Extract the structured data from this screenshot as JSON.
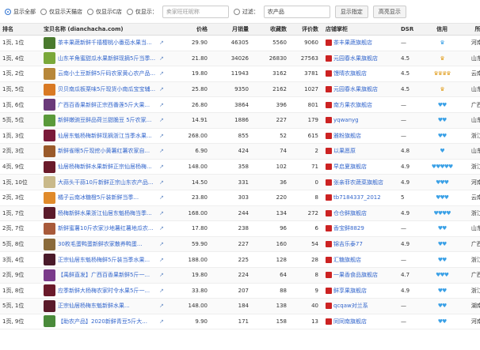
{
  "toolbar": {
    "radio_all": "显示全部",
    "radio_tmall": "仅显示天猫店",
    "radio_c": "仅显示C店",
    "radio_show": "仅显示：",
    "keyword_placeholder": "卖家旺旺昵称",
    "filter_label": "过滤：",
    "filter_value": "农产品",
    "btn_show_assign": "显示指定",
    "btn_highlight": "高亮显示"
  },
  "headers": [
    "排名",
    "宝贝名称 (dianchacha.com)",
    "价格",
    "月销量",
    "收藏数",
    "评价数",
    "店铺掌柜",
    "DSR",
    "信用",
    "所在地"
  ],
  "rows": [
    {
      "rank": "1页, 1位",
      "title": "茶丰果蔬新鲜千禧樱桃小番茄水果当...",
      "thumb": "#4a7a2e",
      "price": "29.90",
      "sales": "46305",
      "fav": "5560",
      "reviews": "9060",
      "shop_color": "#cc2222",
      "shop": "茶丰果蔬旗舰店",
      "dsr": "—",
      "credit": "♛",
      "credit_type": "blue",
      "loc": "河南 安阳"
    },
    {
      "rank": "1页, 4位",
      "title": "山东羊角蜜甜瓜水果新鲜现摘5斤当季...",
      "thumb": "#7aa83a",
      "price": "21.80",
      "sales": "34026",
      "fav": "26830",
      "reviews": "27563",
      "shop_color": "#cc2222",
      "shop": "元园春水果旗舰店",
      "dsr": "4.5",
      "credit": "♛",
      "credit_type": "gold",
      "loc": "山东 潍坊"
    },
    {
      "rank": "1页, 2位",
      "title": "云南小土豆新鲜5斤码农家黄心农产品...",
      "thumb": "#b7873a",
      "price": "19.80",
      "sales": "11943",
      "fav": "3162",
      "reviews": "3781",
      "shop_color": "#cc2222",
      "shop": "馒晴农旗舰店",
      "dsr": "4.5",
      "credit": "♛♛♛♛",
      "credit_type": "gold",
      "loc": "云南 昆明"
    },
    {
      "rank": "1页, 5位",
      "title": "贝贝南瓜板栗味5斤现货小南瓜宝宝辅...",
      "thumb": "#d97a24",
      "price": "25.80",
      "sales": "9350",
      "fav": "2162",
      "reviews": "1027",
      "shop_color": "#cc2222",
      "shop": "元园春水果旗舰店",
      "dsr": "4.5",
      "credit": "♛",
      "credit_type": "gold",
      "loc": "山东 潍坊"
    },
    {
      "rank": "1页, 6位",
      "title": "广西百香果新鲜正宗西番莲5斤大果...",
      "thumb": "#6a3a7a",
      "price": "26.80",
      "sales": "3864",
      "fav": "396",
      "reviews": "801",
      "shop_color": "#cc2222",
      "shop": "南方果农旗舰店",
      "dsr": "—",
      "credit": "♥♥",
      "credit_type": "blue",
      "loc": "广西 桂林"
    },
    {
      "rank": "5页, 5位",
      "title": "新鲜嫩豌豆鲜品荷兰甜脆豆 5斤农家...",
      "thumb": "#5a9a3a",
      "price": "14.91",
      "sales": "1886",
      "fav": "227",
      "reviews": "179",
      "shop_color": "#cc2222",
      "shop": "yqwanyg",
      "dsr": "—",
      "credit": "♥♥",
      "credit_type": "blue",
      "loc": "山东 烟台"
    },
    {
      "rank": "1页, 3位",
      "title": "仙居东魁杨梅新鲜现摘浙江当季水果...",
      "thumb": "#7a1a3a",
      "price": "268.00",
      "sales": "855",
      "fav": "52",
      "reviews": "615",
      "shop_color": "#cc2222",
      "shop": "雅粉旗舰店",
      "dsr": "—",
      "credit": "♥♥",
      "credit_type": "blue",
      "loc": "浙江 台州"
    },
    {
      "rank": "2页, 3位",
      "title": "新鲜雀眼5斤现挖小黄薯红薯农家自...",
      "thumb": "#9a5a2a",
      "price": "6.90",
      "sales": "424",
      "fav": "74",
      "reviews": "2",
      "shop_color": "#cc2222",
      "shop": "以果愿原",
      "dsr": "4.8",
      "credit": "♥",
      "credit_type": "blue",
      "loc": "山东 临沂"
    },
    {
      "rank": "4页, 9位",
      "title": "仙居杨梅新鲜水果新鲜正宗仙居杨梅...",
      "thumb": "#6a1a2a",
      "price": "148.00",
      "sales": "358",
      "fav": "102",
      "reviews": "71",
      "shop_color": "#cc2222",
      "shop": "早启夏旗舰店",
      "dsr": "4.9",
      "credit": "♥♥♥♥♥",
      "credit_type": "blue",
      "loc": "浙江 台州"
    },
    {
      "rank": "1页, 10位",
      "title": "大蒜头干蒜10斤新鲜正宗山东农产品...",
      "thumb": "#c9b98a",
      "price": "14.50",
      "sales": "331",
      "fav": "36",
      "reviews": "0",
      "shop_color": "#cc2222",
      "shop": "张亲菲农蔬菜旗舰店",
      "dsr": "4.9",
      "credit": "♥♥♥",
      "credit_type": "blue",
      "loc": "河南 开封"
    },
    {
      "rank": "2页, 3位",
      "title": "橘子云南冰糖橙5斤装新鲜当季...",
      "thumb": "#e08a2a",
      "price": "23.80",
      "sales": "303",
      "fav": "220",
      "reviews": "8",
      "shop_color": "#cc2222",
      "shop": "tb7184337_2012",
      "dsr": "5",
      "credit": "♥♥♥",
      "credit_type": "blue",
      "loc": "云南 昆明"
    },
    {
      "rank": "1页, 7位",
      "title": "杨梅新鲜水果浙江仙居东魁杨梅当季...",
      "thumb": "#5a1a2a",
      "price": "168.00",
      "sales": "244",
      "fav": "134",
      "reviews": "272",
      "shop_color": "#cc2222",
      "shop": "仓仓鲜旗舰店",
      "dsr": "4.9",
      "credit": "♥♥♥♥",
      "credit_type": "blue",
      "loc": "浙江 台州"
    },
    {
      "rank": "2页, 7位",
      "title": "新鲜蜜薯10斤农家沙地薯红薯地瓜农...",
      "thumb": "#a85a3a",
      "price": "17.80",
      "sales": "238",
      "fav": "96",
      "reviews": "6",
      "shop_color": "#cc2222",
      "shop": "香宝鲜8829",
      "dsr": "—",
      "credit": "♥♥",
      "credit_type": "blue",
      "loc": "山东 烟台"
    },
    {
      "rank": "5页, 8位",
      "title": "30枚毛蛋鸭蛋新鲜农家散养鸭蛋...",
      "thumb": "#8a6a3a",
      "price": "59.90",
      "sales": "227",
      "fav": "160",
      "reviews": "54",
      "shop_color": "#cc2222",
      "shop": "锦吉乐泰77",
      "dsr": "4.9",
      "credit": "♥♥",
      "credit_type": "blue",
      "loc": "广西 贵州"
    },
    {
      "rank": "3页, 4位",
      "title": "正宗仙居东魁杨梅鲜5斤装当季水果...",
      "thumb": "#4a1a2a",
      "price": "188.00",
      "sales": "225",
      "fav": "128",
      "reviews": "28",
      "shop_color": "#cc2222",
      "shop": "汇糖旗舰店",
      "dsr": "—",
      "credit": "♥♥",
      "credit_type": "blue",
      "loc": "浙江 台州"
    },
    {
      "rank": "2页, 9位",
      "title": "【禹鲜直发】广西百香果新鲜5斤一...",
      "thumb": "#7a3a8a",
      "price": "19.80",
      "sales": "224",
      "fav": "64",
      "reviews": "8",
      "shop_color": "#cc2222",
      "shop": "一果香食品旗舰店",
      "dsr": "4.7",
      "credit": "♥♥♥",
      "credit_type": "blue",
      "loc": "广西 南宁"
    },
    {
      "rank": "1页, 8位",
      "title": "应季新鲜大杨梅农家时令水果5斤一...",
      "thumb": "#6a1a2a",
      "price": "33.80",
      "sales": "207",
      "fav": "88",
      "reviews": "9",
      "shop_color": "#cc2222",
      "shop": "鲜享果旗舰店",
      "dsr": "4.9",
      "credit": "♥♥",
      "credit_type": "blue",
      "loc": "浙江 台州"
    },
    {
      "rank": "5页, 1位",
      "title": "正宗仙居杨梅东魁新鲜水果...",
      "thumb": "#5a1a2a",
      "price": "148.00",
      "sales": "184",
      "fav": "138",
      "reviews": "40",
      "shop_color": "#cc2222",
      "shop": "qcqaw对兰系",
      "dsr": "—",
      "credit": "♥♥",
      "credit_type": "blue",
      "loc": "湖南 怀化"
    },
    {
      "rank": "1页, 9位",
      "title": "【助农产品】2020新鲜青豆5斤大...",
      "thumb": "#4a8a3a",
      "price": "9.90",
      "sales": "171",
      "fav": "158",
      "reviews": "13",
      "shop_color": "#cc2222",
      "shop": "同同南旗舰店",
      "dsr": "—",
      "credit": "♥♥",
      "credit_type": "blue",
      "loc": "河南 南阳"
    }
  ]
}
